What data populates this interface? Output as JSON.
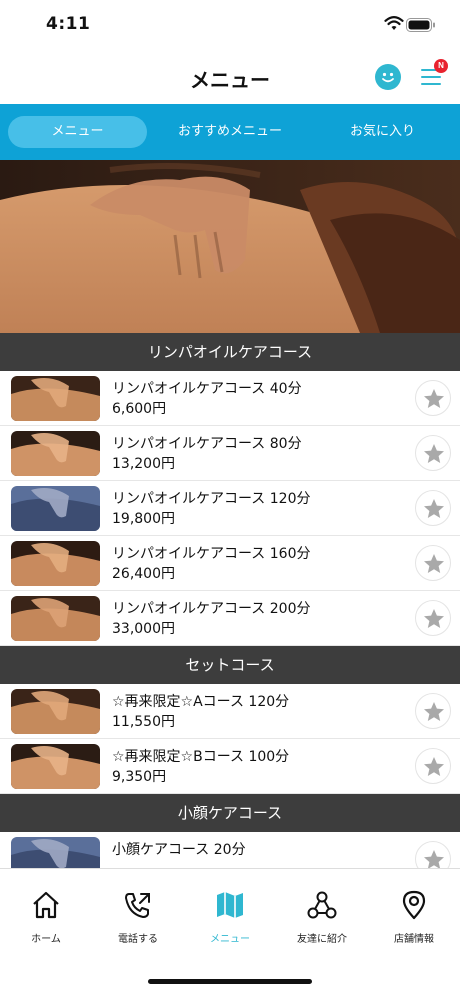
{
  "status": {
    "time": "4:11"
  },
  "header": {
    "title": "メニュー",
    "badge": "N"
  },
  "tabs": [
    {
      "label": "メニュー",
      "active": true
    },
    {
      "label": "おすすめメニュー",
      "active": false
    },
    {
      "label": "お気に入り",
      "active": false
    }
  ],
  "sections": [
    {
      "title": "リンパオイルケアコース",
      "items": [
        {
          "name": "リンパオイルケアコース 40分",
          "price": "6,600円"
        },
        {
          "name": "リンパオイルケアコース 80分",
          "price": "13,200円"
        },
        {
          "name": "リンパオイルケアコース 120分",
          "price": "19,800円"
        },
        {
          "name": "リンパオイルケアコース 160分",
          "price": "26,400円"
        },
        {
          "name": "リンパオイルケアコース 200分",
          "price": "33,000円"
        }
      ]
    },
    {
      "title": "セットコース",
      "items": [
        {
          "name": "☆再来限定☆Aコース 120分",
          "price": "11,550円"
        },
        {
          "name": "☆再来限定☆Bコース 100分",
          "price": "9,350円"
        }
      ]
    },
    {
      "title": "小顔ケアコース",
      "items": [
        {
          "name": "小顔ケアコース 20分",
          "price": ""
        }
      ]
    }
  ],
  "bottom_nav": [
    {
      "label": "ホーム",
      "icon": "home-icon",
      "active": false
    },
    {
      "label": "電話する",
      "icon": "phone-icon",
      "active": false
    },
    {
      "label": "メニュー",
      "icon": "map-book-icon",
      "active": true
    },
    {
      "label": "友達に紹介",
      "icon": "share-network-icon",
      "active": false
    },
    {
      "label": "店舗情報",
      "icon": "location-pin-icon",
      "active": false
    }
  ],
  "colors": {
    "accent": "#2fb7d0",
    "tabbar": "#0ea2d6",
    "section": "#3d3d3d",
    "badge": "#e8232f"
  }
}
